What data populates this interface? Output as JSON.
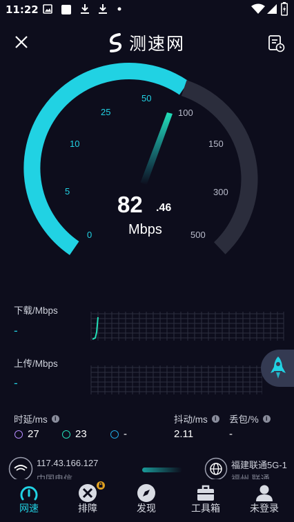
{
  "status_bar": {
    "time": "11:22"
  },
  "header": {
    "title": "测速网"
  },
  "gauge": {
    "ticks_active": [
      "0",
      "5",
      "10",
      "25",
      "50"
    ],
    "ticks_inactive": [
      "100",
      "150",
      "300",
      "500"
    ],
    "speed_integer": "82",
    "speed_decimal": ".46",
    "unit": "Mbps",
    "colors": {
      "accent": "#21d2e3",
      "track": "#2b2d3c"
    }
  },
  "download": {
    "label": "下载/Mbps",
    "value": "-"
  },
  "upload": {
    "label": "上传/Mbps",
    "value": "-"
  },
  "metrics": {
    "latency_label": "时延/ms",
    "jitter_label": "抖动/ms",
    "loss_label": "丢包/%",
    "latency_idle": "27",
    "latency_down": "23",
    "latency_up": "-",
    "jitter": "2.11",
    "loss": "-"
  },
  "server": {
    "ip": "117.43.166.127",
    "isp_partial": "中国电信",
    "node": "福建联通5G-1",
    "node_partial": "福州 联通"
  },
  "nav": {
    "items": [
      {
        "label": "网速",
        "active": true
      },
      {
        "label": "排障",
        "active": false
      },
      {
        "label": "发现",
        "active": false
      },
      {
        "label": "工具箱",
        "active": false
      },
      {
        "label": "未登录",
        "active": false
      }
    ]
  }
}
